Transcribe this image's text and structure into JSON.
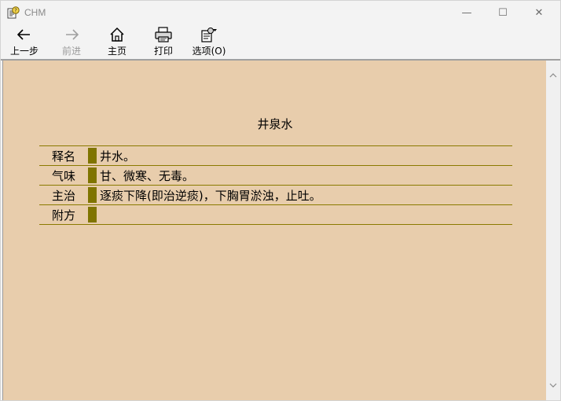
{
  "window": {
    "title": "CHM"
  },
  "controls": {
    "minimize": "—",
    "maximize": "☐",
    "close": "✕"
  },
  "toolbar": {
    "back_label": "上一步",
    "forward_label": "前进",
    "home_label": "主页",
    "print_label": "打印",
    "options_label": "选项(O)"
  },
  "content": {
    "heading": "井泉水",
    "rows": [
      {
        "label": "释名",
        "value": "井水。"
      },
      {
        "label": "气味",
        "value": "甘、微寒、无毒。"
      },
      {
        "label": "主治",
        "value": "逐痰下降(即治逆痰)，下胸胃淤浊，止吐。"
      },
      {
        "label": "附方",
        "value": ""
      }
    ]
  },
  "colors": {
    "content_bg": "#e8cdac",
    "row_marker": "#7f7400",
    "row_line": "#8a7a00"
  }
}
